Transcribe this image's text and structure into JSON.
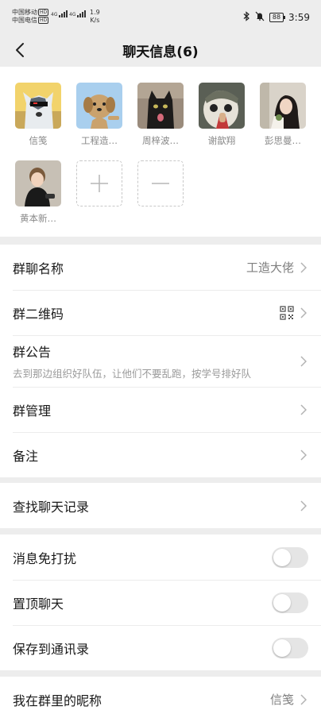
{
  "status_bar": {
    "carrier1": "中国移动",
    "carrier2": "中国电信",
    "hd": "HD",
    "net1": "4G",
    "net2": "4G",
    "speed_value": "1.9",
    "speed_unit": "K/s",
    "battery": "88",
    "time": "3:59"
  },
  "header": {
    "title": "聊天信息(6)"
  },
  "members": [
    {
      "name": "信笺",
      "avatar": "husky-meme-avatar"
    },
    {
      "name": "工程造…",
      "avatar": "cartoon-dog-avatar"
    },
    {
      "name": "周梓波…",
      "avatar": "black-cat-avatar"
    },
    {
      "name": "谢歆翔",
      "avatar": "masked-figure-avatar"
    },
    {
      "name": "彭思曼…",
      "avatar": "girl-photo-avatar"
    },
    {
      "name": "黄本新…",
      "avatar": "toddler-photo-avatar"
    }
  ],
  "settings": {
    "group_name_label": "群聊名称",
    "group_name_value": "工造大佬",
    "qr_label": "群二维码",
    "notice_label": "群公告",
    "notice_text": "去到那边组织好队伍，让他们不要乱跑，按学号排好队",
    "manage_label": "群管理",
    "remark_label": "备注",
    "search_history_label": "查找聊天记录",
    "mute_label": "消息免打扰",
    "pin_label": "置顶聊天",
    "save_contacts_label": "保存到通讯录",
    "nickname_label": "我在群里的昵称",
    "nickname_value": "信笺"
  },
  "toggles": {
    "mute": false,
    "pin": false,
    "save_contacts": false
  }
}
